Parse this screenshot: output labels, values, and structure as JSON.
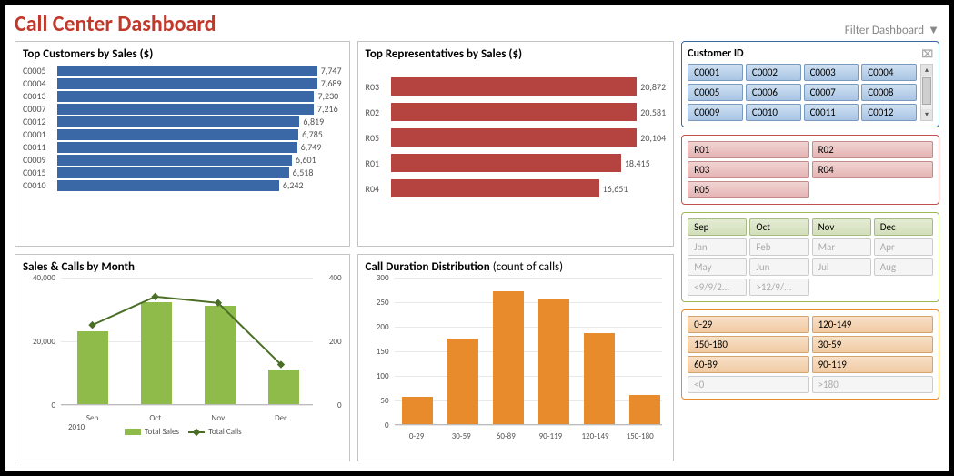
{
  "title": "Call Center Dashboard",
  "filter_link": "Filter Dashboard",
  "panels": {
    "top_customers": {
      "title": "Top Customers by Sales ($)",
      "max": 8000
    },
    "top_reps": {
      "title": "Top Representatives by Sales ($)",
      "max": 22000
    },
    "sales_calls": {
      "title": "Sales & Calls by Month",
      "year": "2010",
      "legend_sales": "Total Sales",
      "legend_calls": "Total Calls"
    },
    "duration": {
      "title_main": "Call Duration Distribution",
      "title_sub": " (count of calls)"
    }
  },
  "slicers": {
    "customer_title": "Customer ID",
    "customer_ids": [
      "C0001",
      "C0002",
      "C0003",
      "C0004",
      "C0005",
      "C0006",
      "C0007",
      "C0008",
      "C0009",
      "C0010",
      "C0011",
      "C0012"
    ],
    "reps": [
      "R01",
      "R02",
      "R03",
      "R04",
      "R05"
    ],
    "months_active": [
      "Sep",
      "Oct",
      "Nov",
      "Dec"
    ],
    "months_dim": [
      "Jan",
      "Feb",
      "Mar",
      "Apr",
      "May",
      "Jun",
      "Jul",
      "Aug",
      "<9/9/2...",
      ">12/9/..."
    ],
    "durations_active": [
      "0-29",
      "120-149",
      "150-180",
      "30-59",
      "60-89",
      "90-119"
    ],
    "durations_dim": [
      "<0",
      ">180"
    ]
  },
  "chart_data": [
    {
      "id": "top_customers",
      "type": "bar",
      "orientation": "horizontal",
      "title": "Top Customers by Sales ($)",
      "categories": [
        "C0005",
        "C0004",
        "C0013",
        "C0007",
        "C0012",
        "C0001",
        "C0011",
        "C0009",
        "C0015",
        "C0010"
      ],
      "values": [
        7747,
        7689,
        7230,
        7216,
        6819,
        6785,
        6749,
        6601,
        6518,
        6242
      ],
      "xlim": [
        0,
        8000
      ]
    },
    {
      "id": "top_reps",
      "type": "bar",
      "orientation": "horizontal",
      "title": "Top Representatives by Sales ($)",
      "categories": [
        "R03",
        "R02",
        "R05",
        "R01",
        "R04"
      ],
      "values": [
        20872,
        20581,
        20104,
        18415,
        16651
      ],
      "xlim": [
        0,
        22000
      ]
    },
    {
      "id": "sales_calls",
      "type": "combo",
      "title": "Sales & Calls by Month",
      "categories": [
        "Sep",
        "Oct",
        "Nov",
        "Dec"
      ],
      "year": "2010",
      "series": [
        {
          "name": "Total Sales",
          "type": "bar",
          "axis": "left",
          "values": [
            23000,
            32000,
            31000,
            11000
          ]
        },
        {
          "name": "Total Calls",
          "type": "line",
          "axis": "right",
          "values": [
            250,
            340,
            320,
            125
          ]
        }
      ],
      "ylim_left": [
        0,
        40000
      ],
      "ylim_right": [
        0,
        400
      ],
      "yticks_left": [
        0,
        20000,
        40000
      ],
      "yticks_right": [
        0,
        200,
        400
      ]
    },
    {
      "id": "duration",
      "type": "bar",
      "title": "Call Duration Distribution (count of calls)",
      "categories": [
        "0-29",
        "30-59",
        "60-89",
        "90-119",
        "120-149",
        "150-180"
      ],
      "values": [
        55,
        175,
        270,
        255,
        185,
        60
      ],
      "ylim": [
        0,
        300
      ],
      "yticks": [
        0,
        50,
        100,
        150,
        200,
        250,
        300
      ]
    }
  ]
}
